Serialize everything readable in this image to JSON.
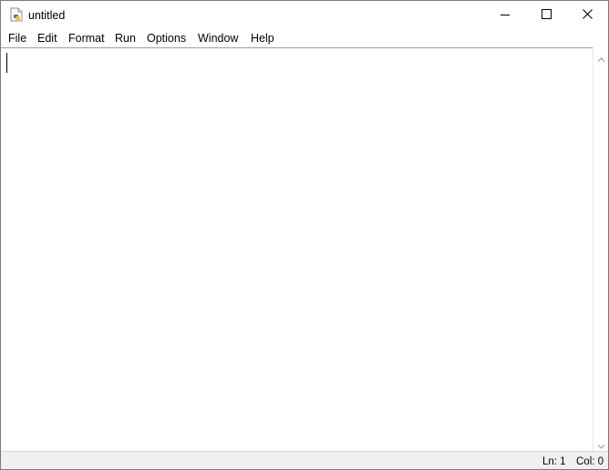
{
  "window": {
    "title": "untitled"
  },
  "menu": {
    "items": [
      {
        "label": "File"
      },
      {
        "label": "Edit"
      },
      {
        "label": "Format"
      },
      {
        "label": "Run"
      },
      {
        "label": "Options"
      },
      {
        "label": "Window"
      },
      {
        "label": "Help"
      }
    ]
  },
  "editor": {
    "content": ""
  },
  "status": {
    "line": "Ln: 1",
    "column": "Col: 0"
  },
  "icons": {
    "app": "python-file-icon",
    "minimize": "minimize-icon",
    "maximize": "maximize-icon",
    "close": "close-icon",
    "scroll_up": "chevron-up-icon",
    "scroll_down": "chevron-down-icon"
  },
  "colors": {
    "status_bar": "#f0f0f0",
    "window_border": "#7a7a7a"
  }
}
